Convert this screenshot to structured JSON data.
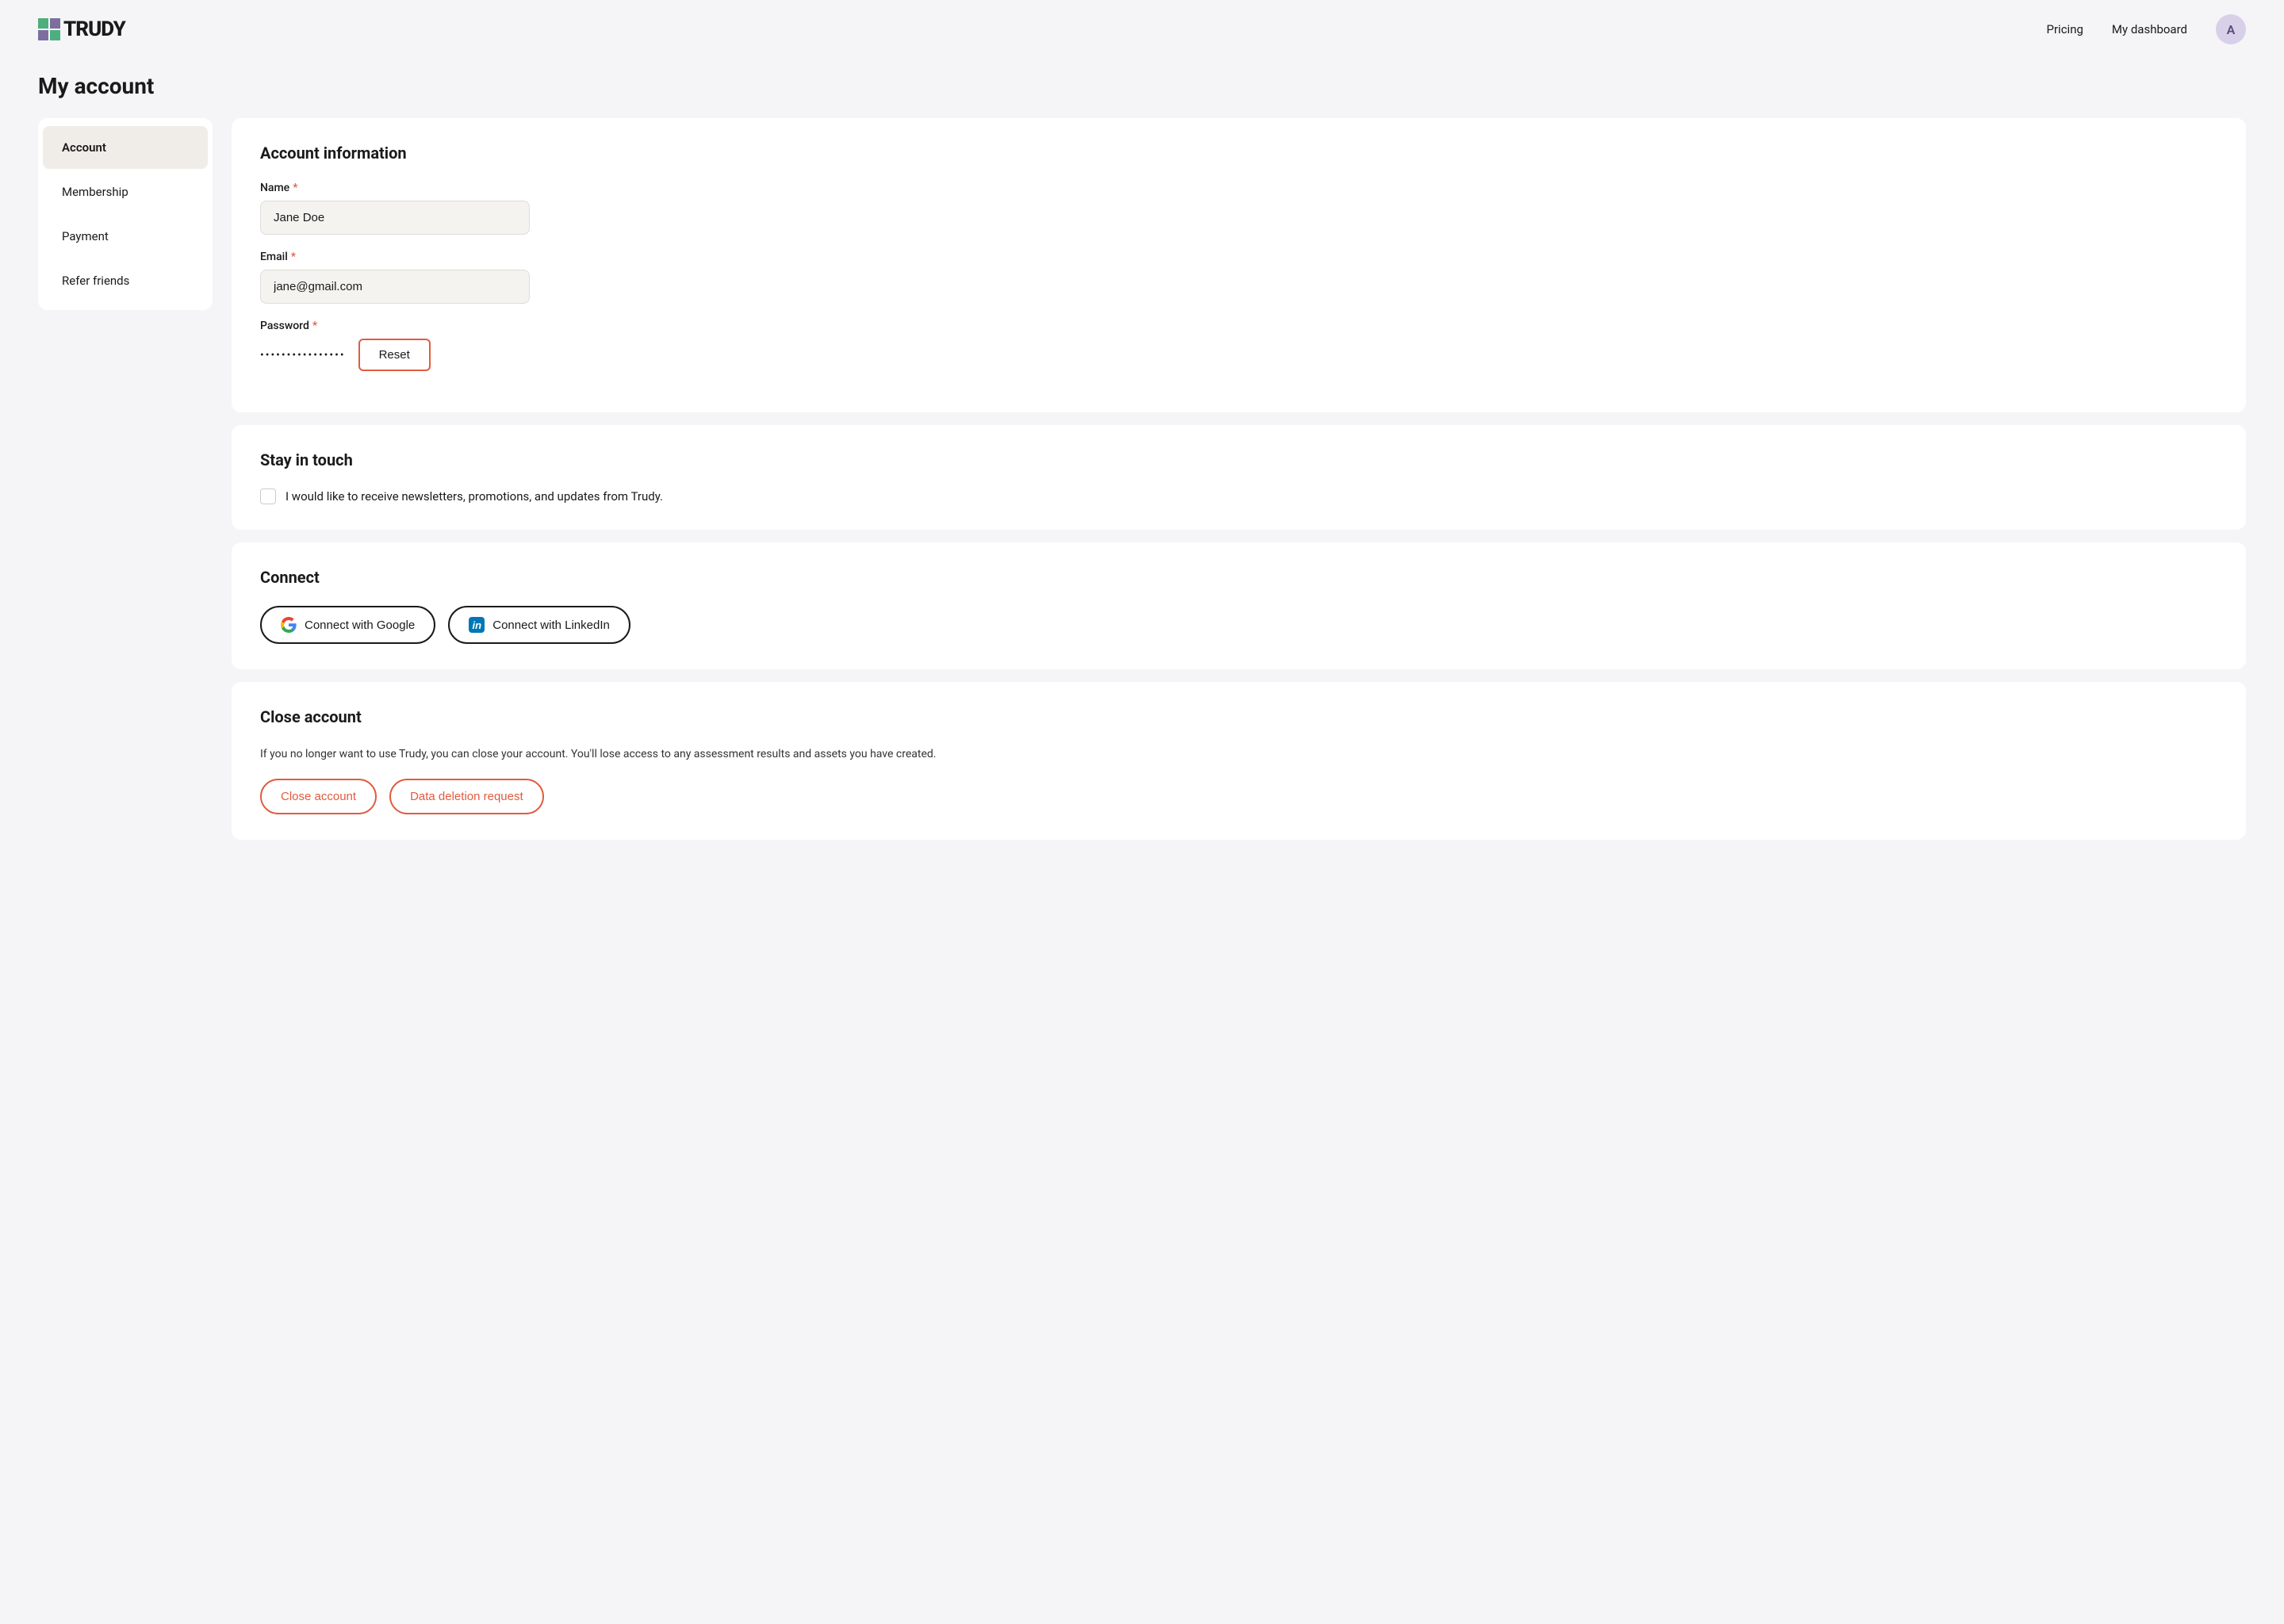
{
  "brand": {
    "name": "TRUDY",
    "logo_letter": "T"
  },
  "nav": {
    "pricing_label": "Pricing",
    "dashboard_label": "My dashboard",
    "avatar_letter": "A"
  },
  "page": {
    "title": "My account"
  },
  "sidebar": {
    "items": [
      {
        "label": "Account",
        "active": true
      },
      {
        "label": "Membership",
        "active": false
      },
      {
        "label": "Payment",
        "active": false
      },
      {
        "label": "Refer friends",
        "active": false
      }
    ]
  },
  "account_info": {
    "section_title": "Account information",
    "name_label": "Name",
    "name_value": "Jane Doe",
    "email_label": "Email",
    "email_value": "jane@gmail.com",
    "password_label": "Password",
    "password_dots": "••••••••••••••••",
    "reset_label": "Reset"
  },
  "stay_in_touch": {
    "section_title": "Stay in touch",
    "checkbox_label": "I would like to receive newsletters, promotions, and updates from Trudy."
  },
  "connect": {
    "section_title": "Connect",
    "google_label": "Connect with Google",
    "linkedin_label": "Connect with LinkedIn"
  },
  "close_account": {
    "section_title": "Close account",
    "description": "If you no longer want to use Trudy, you can close your account. You'll lose access to any assessment results and assets you have created.",
    "close_label": "Close account",
    "deletion_label": "Data deletion request"
  }
}
